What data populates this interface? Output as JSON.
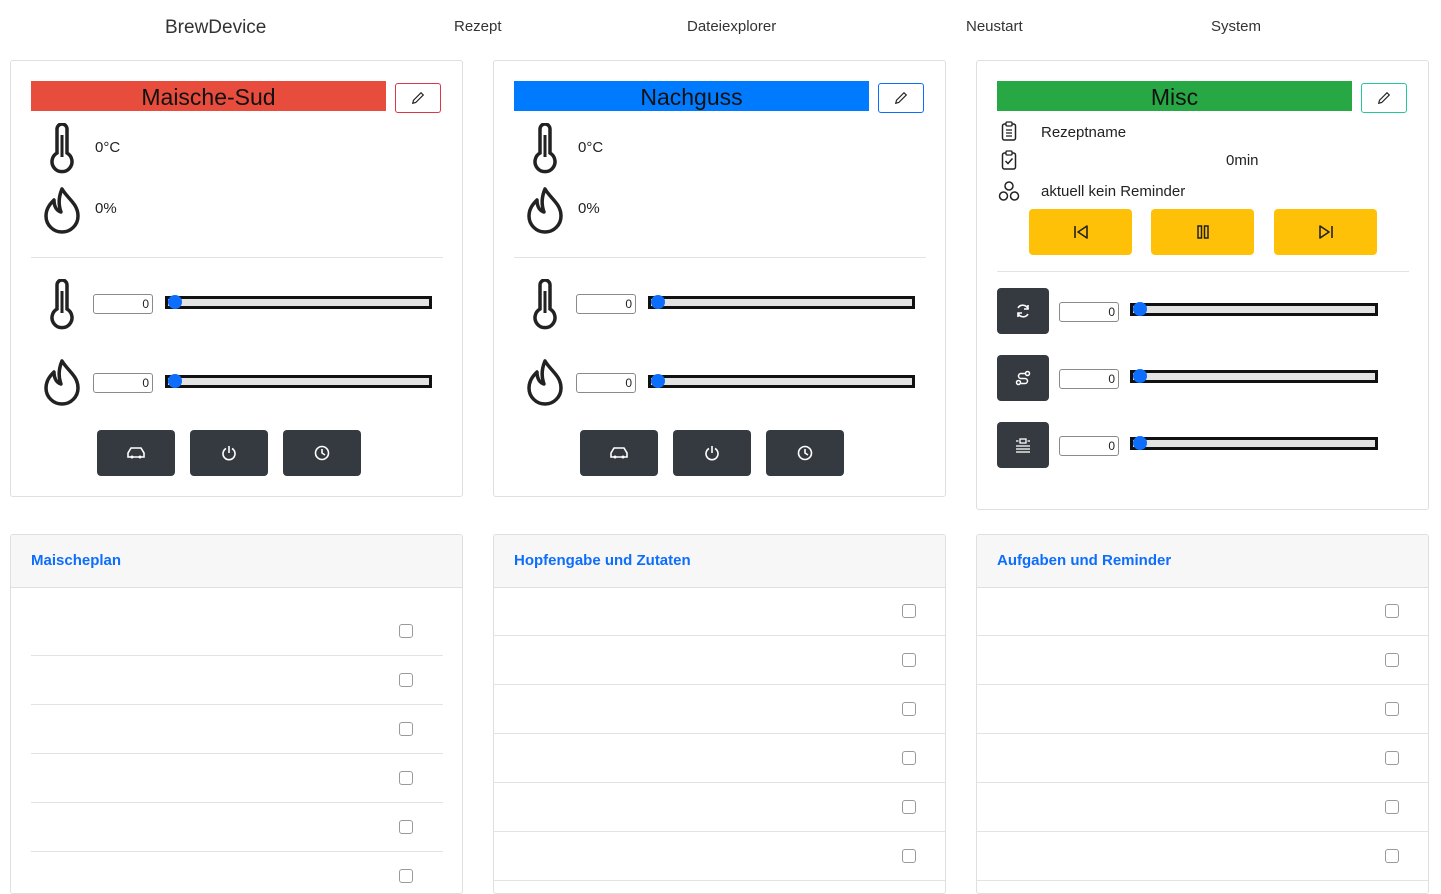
{
  "nav": {
    "brand": "BrewDevice",
    "items": [
      "Rezept",
      "Dateiexplorer",
      "Neustart",
      "System"
    ]
  },
  "colors": {
    "mash": "#e74c3c",
    "sparge": "#007bff",
    "misc": "#28a745",
    "dark_button": "#343a40",
    "yellow_button": "#ffc107",
    "accent": "#0d6efd"
  },
  "mash": {
    "title": "Maische-Sud",
    "temperature": "0°C",
    "power": "0%",
    "temp_setpoint": "0",
    "power_setpoint": "0",
    "temp_slider_value": 0,
    "power_slider_value": 0,
    "buttons": [
      "car-icon",
      "power-icon",
      "clock-icon"
    ]
  },
  "sparge": {
    "title": "Nachguss",
    "temperature": "0°C",
    "power": "0%",
    "temp_setpoint": "0",
    "power_setpoint": "0",
    "temp_slider_value": 0,
    "power_slider_value": 0,
    "buttons": [
      "car-icon",
      "power-icon",
      "clock-icon"
    ]
  },
  "misc": {
    "title": "Misc",
    "recipe_name": "Rezeptname",
    "time": "0min",
    "reminder": "aktuell kein Reminder",
    "controls": [
      "skip-back-icon",
      "pause-icon",
      "skip-forward-icon"
    ],
    "slider1_value": "0",
    "slider2_value": "0",
    "slider3_value": "0"
  },
  "lists": {
    "mash_plan": {
      "title": "Maischeplan"
    },
    "hops": {
      "title": "Hopfengabe und Zutaten"
    },
    "tasks": {
      "title": "Aufgaben und Reminder"
    }
  }
}
